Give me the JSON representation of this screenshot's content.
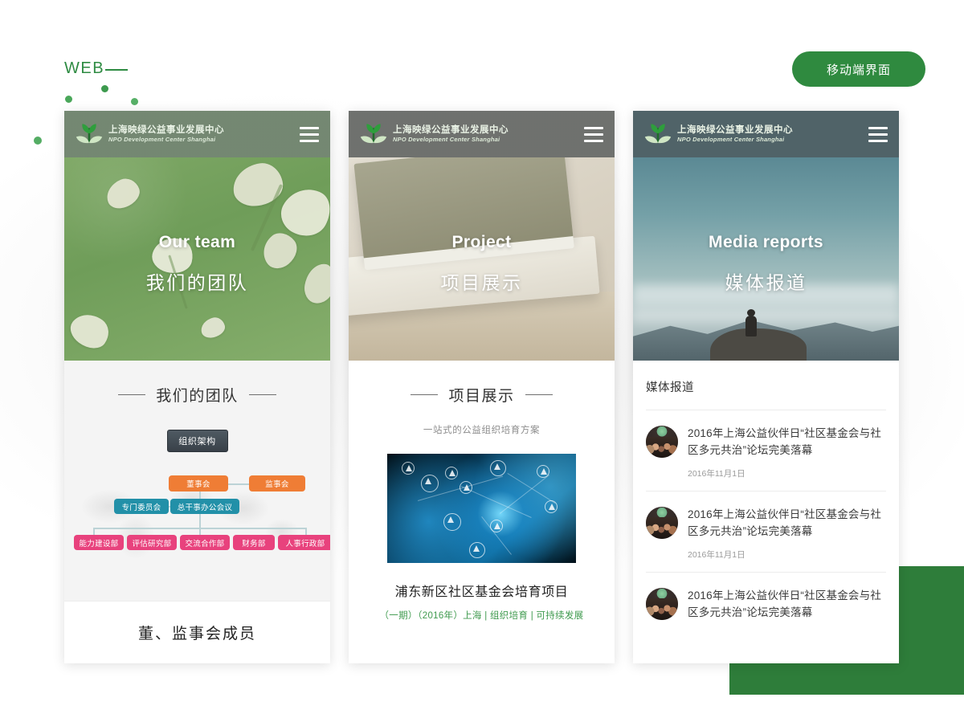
{
  "page": {
    "web_label": "WEB",
    "badge_label": "移动端界面"
  },
  "brand": {
    "name_cn": "上海映绿公益事业发展中心",
    "name_en": "NPO Development Center Shanghai",
    "logo_icon": "sprout-leaf-icon",
    "menu_icon": "hamburger-menu-icon"
  },
  "cards": [
    {
      "id": "our-team",
      "hero": {
        "en": "Our team",
        "cn": "我们的团队",
        "image": "green-leaf-petals-photo"
      },
      "section_title": "我们的团队",
      "org_button": "组织架构",
      "org_chart": {
        "level1": [
          "董事会",
          "监事会"
        ],
        "level2": [
          "专门委员会",
          "总干事办公会议"
        ],
        "level3": [
          "能力建设部",
          "评估研究部",
          "交流合作部",
          "财务部",
          "人事行政部"
        ],
        "colors": {
          "level1": "#ef7d35",
          "level2": "#2290a8",
          "level3": "#e8427d"
        }
      },
      "footer_title": "董、监事会成员"
    },
    {
      "id": "project",
      "hero": {
        "en": "Project",
        "cn": "项目展示",
        "image": "stacked-books-photo"
      },
      "section_title": "项目展示",
      "subtitle": "一站式的公益组织培育方案",
      "thumbnail": "blue-network-map-photo",
      "project_title": "浦东新区社区基金会培育项目",
      "project_meta": "（一期）（2016年）上海 | 组织培育 | 可持续发展",
      "meta_color": "#3f9a4e"
    },
    {
      "id": "media-reports",
      "hero": {
        "en": "Media reports",
        "cn": "媒体报道",
        "image": "mountain-summit-sky-photo"
      },
      "section_title": "媒体报道",
      "news": [
        {
          "title": "2016年上海公益伙伴日“社区基金会与社区多元共治”论坛完美落幕",
          "date": "2016年11月1日",
          "avatar": "group-photo-avatar"
        },
        {
          "title": "2016年上海公益伙伴日“社区基金会与社区多元共治”论坛完美落幕",
          "date": "2016年11月1日",
          "avatar": "group-photo-avatar"
        },
        {
          "title": "2016年上海公益伙伴日“社区基金会与社区多元共治”论坛完美落幕",
          "date": "",
          "avatar": "group-photo-avatar"
        }
      ]
    }
  ],
  "decor": {
    "accent_green": "#2e8b42",
    "block_green": "#2e7d3a",
    "dot_count": 4
  }
}
